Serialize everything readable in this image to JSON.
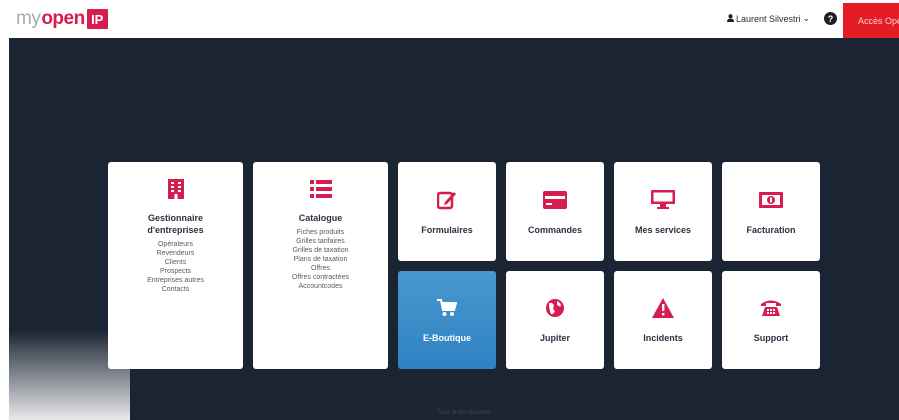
{
  "header": {
    "logo": {
      "part1": "my",
      "part2": "open",
      "part3": "IP"
    },
    "user": {
      "name": "Laurent Silvestri",
      "caret": "⌄"
    },
    "help_label": "?",
    "access_button": "Accès Open"
  },
  "tiles": {
    "gestionnaire": {
      "title_line1": "Gestionnaire",
      "title_line2": "d'entreprises",
      "items": [
        "Opérateurs",
        "Revendeurs",
        "Clients",
        "Prospects",
        "Entreprises autres",
        "Contacts"
      ]
    },
    "catalogue": {
      "title": "Catalogue",
      "items": [
        "Fiches produits",
        "Grilles tarifaires",
        "Grilles de taxation",
        "Plans de taxation",
        "Offres",
        "Offres contractées",
        "Accountcodes"
      ]
    },
    "formulaires": {
      "title": "Formulaires"
    },
    "commandes": {
      "title": "Commandes"
    },
    "mes_services": {
      "title": "Mes services"
    },
    "facturation": {
      "title": "Facturation"
    },
    "eboutique": {
      "title": "E-Boutique"
    },
    "jupiter": {
      "title": "Jupiter"
    },
    "incidents": {
      "title": "Incidents"
    },
    "support": {
      "title": "Support"
    }
  },
  "footer": {
    "text": "Tous droits réservés"
  },
  "colors": {
    "brand": "#d71c4f",
    "background": "#1b2432",
    "active_tile": "#3d8fcf",
    "access": "#e31d23"
  },
  "icons": [
    "building-icon",
    "list-icon",
    "edit-icon",
    "card-icon",
    "monitor-icon",
    "money-icon",
    "cart-icon",
    "globe-icon",
    "warning-icon",
    "phone-icon",
    "user-icon",
    "help-icon"
  ]
}
